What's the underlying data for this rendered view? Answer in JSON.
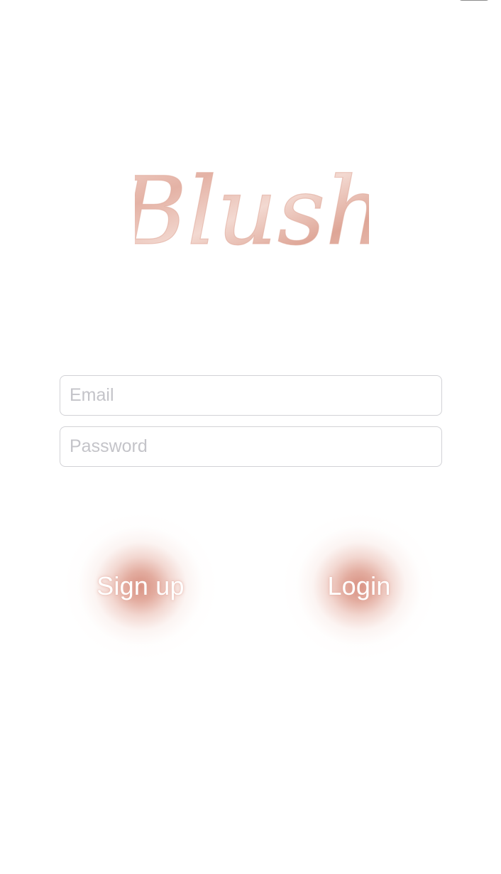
{
  "app": {
    "logo_text": "Blush"
  },
  "form": {
    "email_placeholder": "Email",
    "email_value": "",
    "password_placeholder": "Password",
    "password_value": ""
  },
  "actions": {
    "signup_label": "Sign up",
    "login_label": "Login"
  },
  "colors": {
    "background": "#ffffff",
    "blush_accent": "#d68c7c",
    "logo_pink": "#e9bfb3",
    "field_border": "#d2d2d6",
    "placeholder": "#c4c4c9"
  }
}
